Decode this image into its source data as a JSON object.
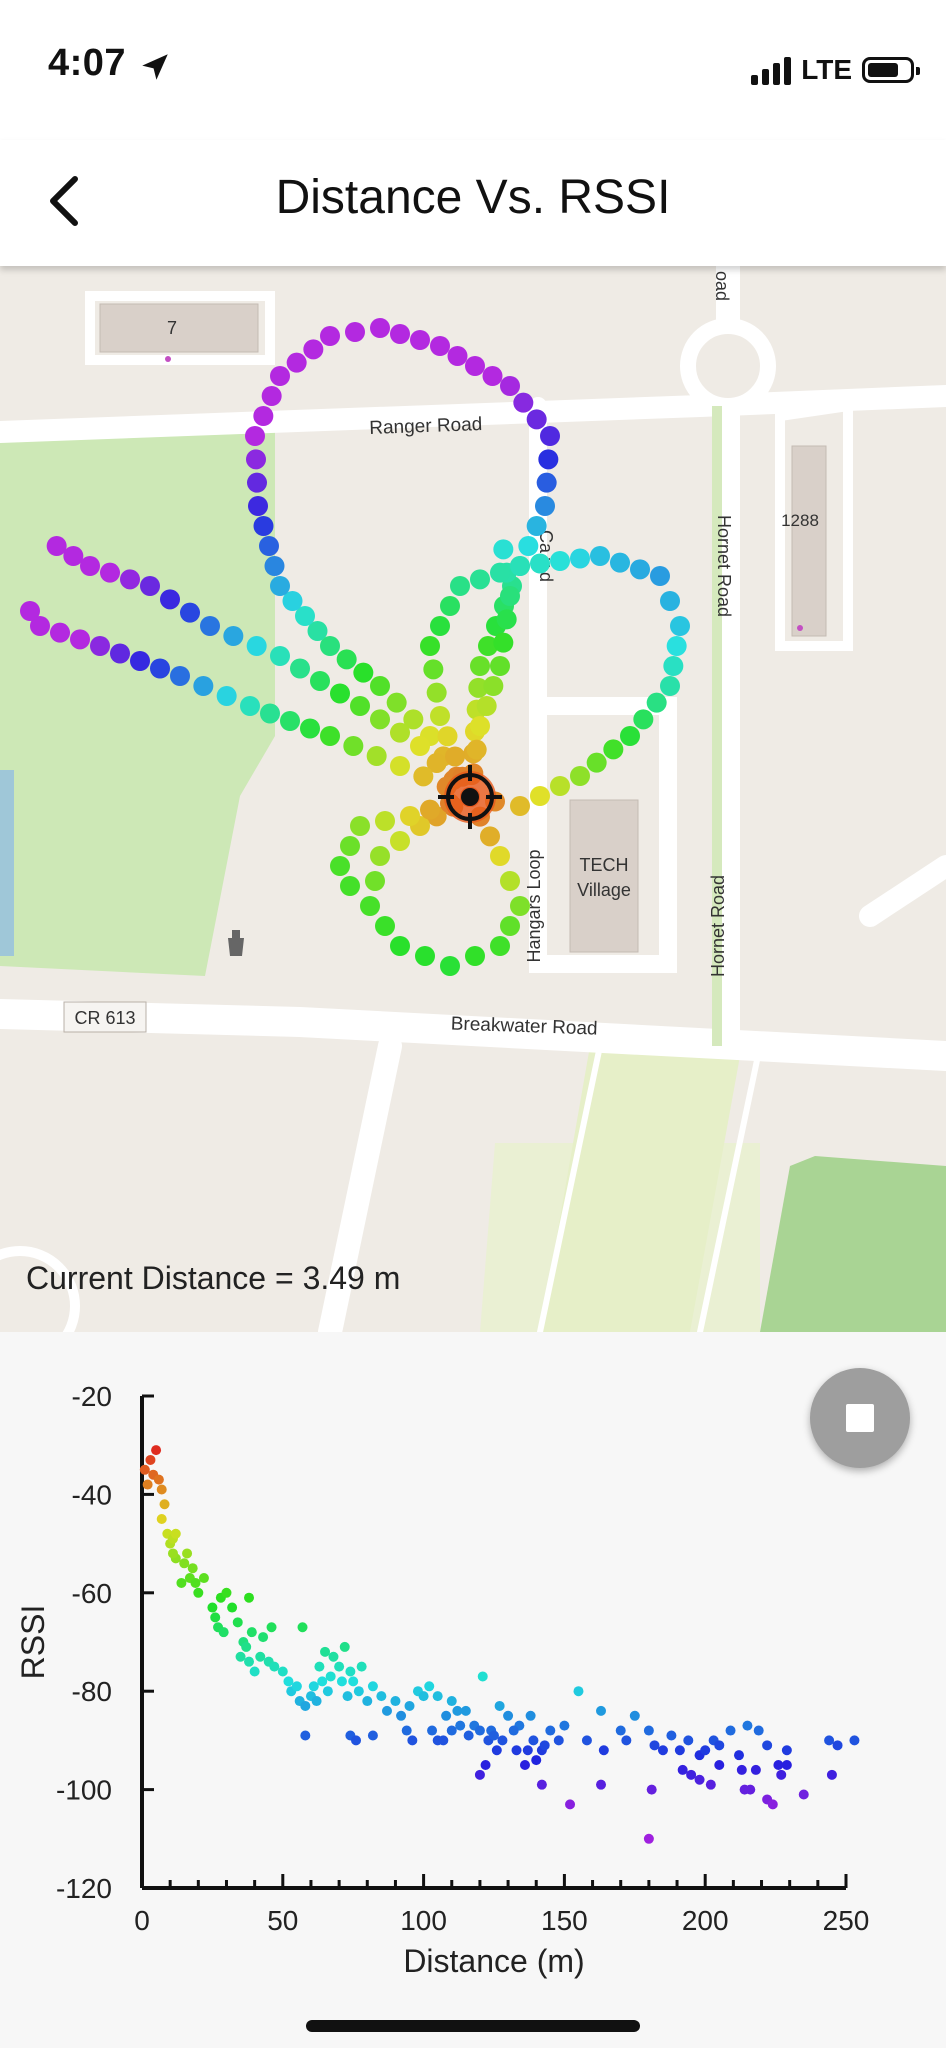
{
  "status_bar": {
    "time": "4:07",
    "network": "LTE"
  },
  "header": {
    "title": "Distance Vs. RSSI"
  },
  "map": {
    "labels": {
      "building_7": "7",
      "ranger_road": "Ranger Road",
      "hornet_road_1": "Hornet Road",
      "hornet_road_2": "Hornet Road",
      "building_1288": "1288",
      "hangars_loop": "Hangars Loop",
      "tech_village_1": "TECH",
      "tech_village_2": "Village",
      "cr613": "CR 613",
      "breakwater_road": "Breakwater Road",
      "partial_road_top": "oad",
      "partial_road_mid": "Ca   y   d"
    },
    "current_distance": "Current Distance = 3.49 m"
  },
  "chart_data": {
    "type": "scatter",
    "xlabel": "Distance (m)",
    "ylabel": "RSSI",
    "xlim": [
      0,
      250
    ],
    "ylim": [
      -120,
      -20
    ],
    "x_ticks": [
      "0",
      "50",
      "100",
      "150",
      "200",
      "250"
    ],
    "y_ticks": [
      "-20",
      "-40",
      "-60",
      "-80",
      "-100",
      "-120"
    ],
    "points": [
      {
        "x": 1,
        "y": -35
      },
      {
        "x": 2,
        "y": -38
      },
      {
        "x": 3,
        "y": -33
      },
      {
        "x": 4,
        "y": -36
      },
      {
        "x": 5,
        "y": -31
      },
      {
        "x": 6,
        "y": -37
      },
      {
        "x": 7,
        "y": -39
      },
      {
        "x": 8,
        "y": -42
      },
      {
        "x": 7,
        "y": -45
      },
      {
        "x": 9,
        "y": -48
      },
      {
        "x": 10,
        "y": -50
      },
      {
        "x": 11,
        "y": -49
      },
      {
        "x": 12,
        "y": -53
      },
      {
        "x": 11,
        "y": -52
      },
      {
        "x": 12,
        "y": -48
      },
      {
        "x": 14,
        "y": -58
      },
      {
        "x": 15,
        "y": -54
      },
      {
        "x": 16,
        "y": -52
      },
      {
        "x": 17,
        "y": -57
      },
      {
        "x": 18,
        "y": -55
      },
      {
        "x": 19,
        "y": -58
      },
      {
        "x": 20,
        "y": -60
      },
      {
        "x": 22,
        "y": -57
      },
      {
        "x": 25,
        "y": -63
      },
      {
        "x": 26,
        "y": -65
      },
      {
        "x": 27,
        "y": -67
      },
      {
        "x": 28,
        "y": -61
      },
      {
        "x": 29,
        "y": -68
      },
      {
        "x": 30,
        "y": -60
      },
      {
        "x": 32,
        "y": -63
      },
      {
        "x": 34,
        "y": -66
      },
      {
        "x": 36,
        "y": -70
      },
      {
        "x": 38,
        "y": -61
      },
      {
        "x": 39,
        "y": -68
      },
      {
        "x": 35,
        "y": -73
      },
      {
        "x": 37,
        "y": -71
      },
      {
        "x": 38,
        "y": -74
      },
      {
        "x": 40,
        "y": -76
      },
      {
        "x": 42,
        "y": -73
      },
      {
        "x": 43,
        "y": -69
      },
      {
        "x": 45,
        "y": -74
      },
      {
        "x": 46,
        "y": -67
      },
      {
        "x": 47,
        "y": -75
      },
      {
        "x": 50,
        "y": -76
      },
      {
        "x": 52,
        "y": -78
      },
      {
        "x": 53,
        "y": -80
      },
      {
        "x": 55,
        "y": -79
      },
      {
        "x": 56,
        "y": -82
      },
      {
        "x": 57,
        "y": -67
      },
      {
        "x": 58,
        "y": -83
      },
      {
        "x": 60,
        "y": -81
      },
      {
        "x": 61,
        "y": -79
      },
      {
        "x": 62,
        "y": -82
      },
      {
        "x": 63,
        "y": -75
      },
      {
        "x": 64,
        "y": -78
      },
      {
        "x": 65,
        "y": -72
      },
      {
        "x": 66,
        "y": -80
      },
      {
        "x": 67,
        "y": -77
      },
      {
        "x": 68,
        "y": -73
      },
      {
        "x": 70,
        "y": -75
      },
      {
        "x": 71,
        "y": -78
      },
      {
        "x": 72,
        "y": -71
      },
      {
        "x": 73,
        "y": -81
      },
      {
        "x": 74,
        "y": -76
      },
      {
        "x": 75,
        "y": -78
      },
      {
        "x": 77,
        "y": -80
      },
      {
        "x": 78,
        "y": -75
      },
      {
        "x": 80,
        "y": -82
      },
      {
        "x": 82,
        "y": -79
      },
      {
        "x": 85,
        "y": -81
      },
      {
        "x": 87,
        "y": -84
      },
      {
        "x": 90,
        "y": -82
      },
      {
        "x": 92,
        "y": -85
      },
      {
        "x": 95,
        "y": -83
      },
      {
        "x": 98,
        "y": -80
      },
      {
        "x": 100,
        "y": -81
      },
      {
        "x": 102,
        "y": -79
      },
      {
        "x": 105,
        "y": -81
      },
      {
        "x": 108,
        "y": -85
      },
      {
        "x": 110,
        "y": -82
      },
      {
        "x": 112,
        "y": -84
      },
      {
        "x": 115,
        "y": -84
      },
      {
        "x": 118,
        "y": -87
      },
      {
        "x": 121,
        "y": -77
      },
      {
        "x": 124,
        "y": -88
      },
      {
        "x": 127,
        "y": -83
      },
      {
        "x": 130,
        "y": -85
      },
      {
        "x": 134,
        "y": -87
      },
      {
        "x": 138,
        "y": -85
      },
      {
        "x": 145,
        "y": -88
      },
      {
        "x": 150,
        "y": -87
      },
      {
        "x": 155,
        "y": -80
      },
      {
        "x": 163,
        "y": -84
      },
      {
        "x": 170,
        "y": -88
      },
      {
        "x": 175,
        "y": -85
      },
      {
        "x": 180,
        "y": -88
      },
      {
        "x": 58,
        "y": -89
      },
      {
        "x": 74,
        "y": -89
      },
      {
        "x": 76,
        "y": -90
      },
      {
        "x": 82,
        "y": -89
      },
      {
        "x": 94,
        "y": -88
      },
      {
        "x": 96,
        "y": -90
      },
      {
        "x": 103,
        "y": -88
      },
      {
        "x": 105,
        "y": -90
      },
      {
        "x": 107,
        "y": -90
      },
      {
        "x": 110,
        "y": -88
      },
      {
        "x": 113,
        "y": -87
      },
      {
        "x": 116,
        "y": -89
      },
      {
        "x": 120,
        "y": -88
      },
      {
        "x": 123,
        "y": -90
      },
      {
        "x": 125,
        "y": -89
      },
      {
        "x": 126,
        "y": -92
      },
      {
        "x": 128,
        "y": -90
      },
      {
        "x": 132,
        "y": -88
      },
      {
        "x": 133,
        "y": -92
      },
      {
        "x": 137,
        "y": -92
      },
      {
        "x": 139,
        "y": -90
      },
      {
        "x": 140,
        "y": -94
      },
      {
        "x": 142,
        "y": -92
      },
      {
        "x": 143,
        "y": -91
      },
      {
        "x": 148,
        "y": -90
      },
      {
        "x": 158,
        "y": -90
      },
      {
        "x": 164,
        "y": -92
      },
      {
        "x": 172,
        "y": -90
      },
      {
        "x": 182,
        "y": -91
      },
      {
        "x": 185,
        "y": -92
      },
      {
        "x": 188,
        "y": -89
      },
      {
        "x": 191,
        "y": -92
      },
      {
        "x": 194,
        "y": -90
      },
      {
        "x": 198,
        "y": -93
      },
      {
        "x": 200,
        "y": -92
      },
      {
        "x": 203,
        "y": -90
      },
      {
        "x": 205,
        "y": -91
      },
      {
        "x": 209,
        "y": -88
      },
      {
        "x": 212,
        "y": -93
      },
      {
        "x": 215,
        "y": -87
      },
      {
        "x": 219,
        "y": -88
      },
      {
        "x": 222,
        "y": -91
      },
      {
        "x": 226,
        "y": -95
      },
      {
        "x": 229,
        "y": -92
      },
      {
        "x": 244,
        "y": -90
      },
      {
        "x": 247,
        "y": -91
      },
      {
        "x": 253,
        "y": -90
      },
      {
        "x": 120,
        "y": -97
      },
      {
        "x": 122,
        "y": -95
      },
      {
        "x": 136,
        "y": -95
      },
      {
        "x": 142,
        "y": -99
      },
      {
        "x": 152,
        "y": -103
      },
      {
        "x": 163,
        "y": -99
      },
      {
        "x": 181,
        "y": -100
      },
      {
        "x": 180,
        "y": -110
      },
      {
        "x": 192,
        "y": -96
      },
      {
        "x": 195,
        "y": -97
      },
      {
        "x": 198,
        "y": -98
      },
      {
        "x": 202,
        "y": -99
      },
      {
        "x": 205,
        "y": -95
      },
      {
        "x": 213,
        "y": -96
      },
      {
        "x": 214,
        "y": -100
      },
      {
        "x": 216,
        "y": -100
      },
      {
        "x": 218,
        "y": -96
      },
      {
        "x": 222,
        "y": -102
      },
      {
        "x": 224,
        "y": -103
      },
      {
        "x": 227,
        "y": -97
      },
      {
        "x": 229,
        "y": -95
      },
      {
        "x": 235,
        "y": -101
      },
      {
        "x": 245,
        "y": -97
      }
    ]
  }
}
